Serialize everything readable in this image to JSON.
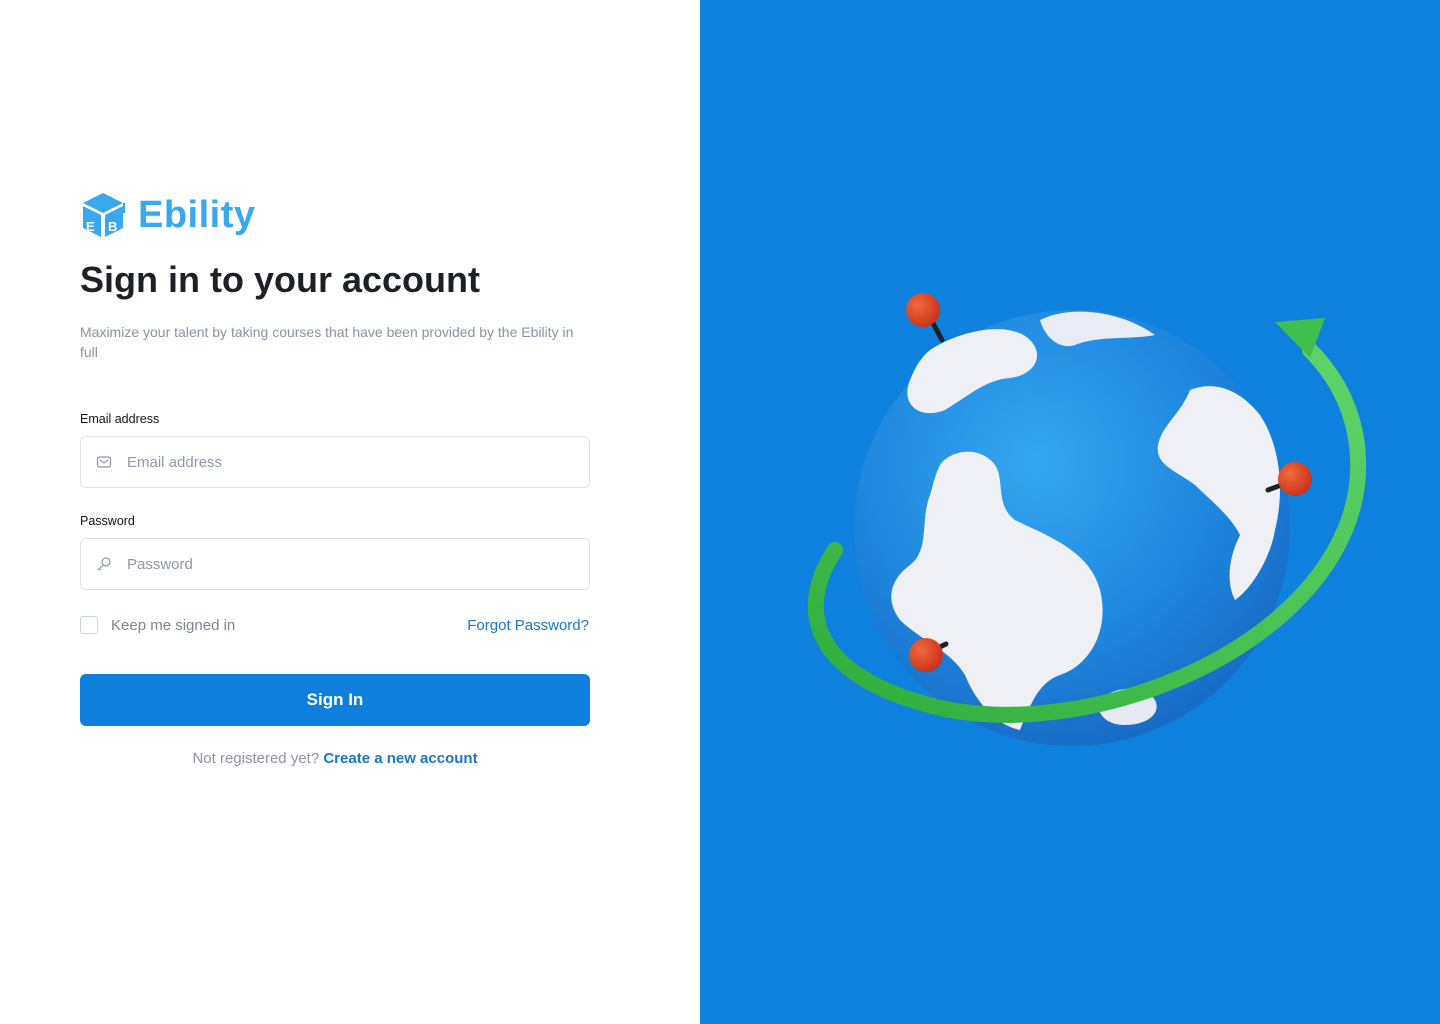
{
  "brand": {
    "name": "Ebility",
    "color": "#3aa8ee"
  },
  "signin": {
    "title": "Sign in to your account",
    "subtitle": "Maximize your talent by taking courses that have been provided by the Ebility in full",
    "email": {
      "label": "Email address",
      "placeholder": "Email address",
      "icon": "mail-icon"
    },
    "password": {
      "label": "Password",
      "placeholder": "Password",
      "icon": "key-icon"
    },
    "remember_label": "Keep me signed in",
    "forgot_label": "Forgot Password?",
    "submit_label": "Sign In",
    "register_prompt": "Not registered yet?",
    "register_link": "Create a new account"
  },
  "illustration": {
    "name": "globe-with-orbit-arrow",
    "background": "#0e80dd"
  },
  "colors": {
    "accent": "#0e7fdc",
    "link": "#1778c9",
    "heading": "#1d2026",
    "muted": "#8a94a3"
  }
}
